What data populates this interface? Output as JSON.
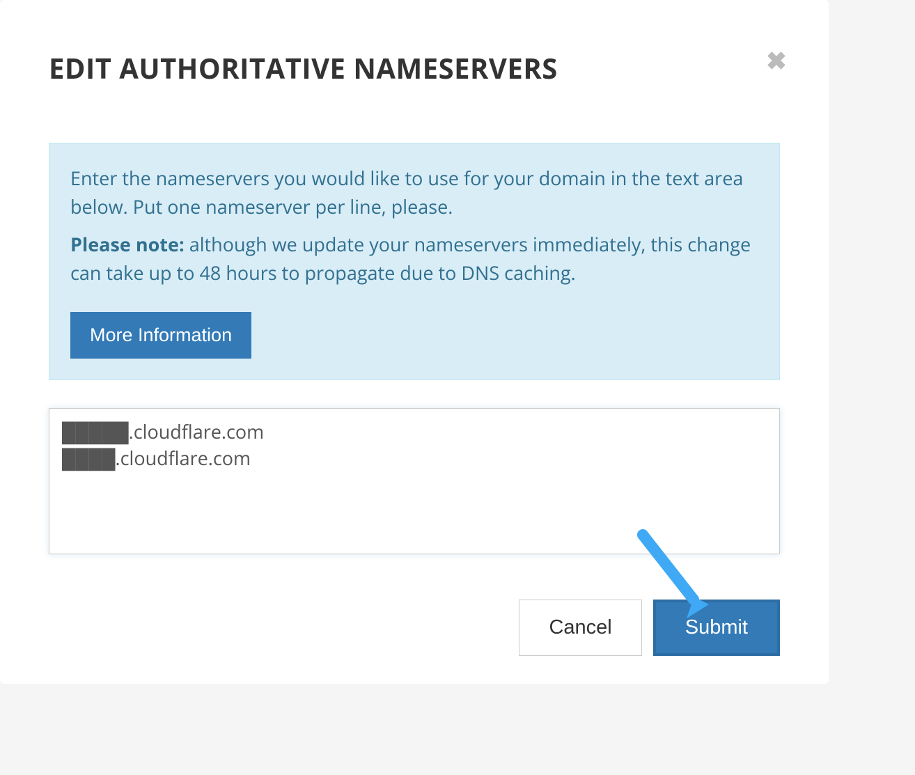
{
  "modal": {
    "title": "EDIT AUTHORITATIVE NAMESERVERS",
    "info_line1": "Enter the nameservers you would like to use for your domain in the text area below. Put one nameserver per line, please.",
    "note_label": "Please note:",
    "note_text": " although we update your nameservers immediately, this change can take up to 48 hours to propagate due to DNS caching.",
    "more_info_label": "More Information",
    "textarea_value": "█████.cloudflare.com\n████.cloudflare.com",
    "cancel_label": "Cancel",
    "submit_label": "Submit"
  }
}
